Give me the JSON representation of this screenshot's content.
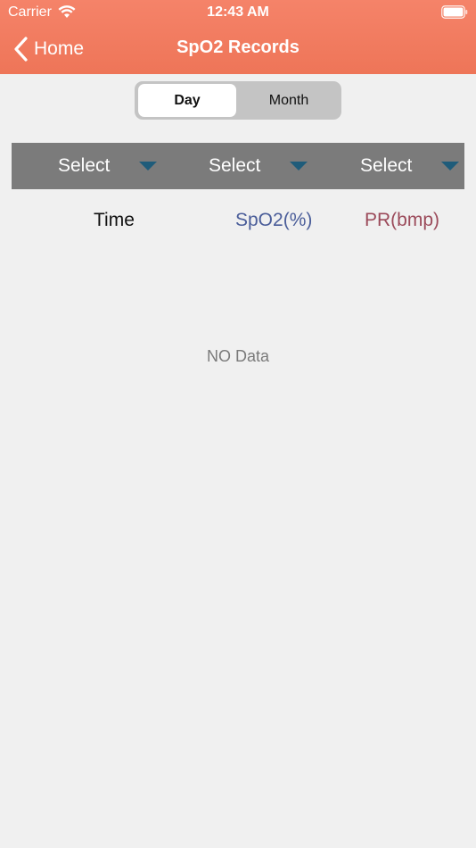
{
  "status_bar": {
    "carrier": "Carrier",
    "time": "12:43 AM",
    "wifi_icon": "wifi-icon",
    "battery_icon": "battery-icon"
  },
  "nav": {
    "back_label": "Home",
    "back_icon": "chevron-left-icon",
    "title": "SpO2 Records"
  },
  "segments": {
    "day": "Day",
    "month": "Month",
    "selected": "Day"
  },
  "filters": [
    {
      "label": "Select",
      "icon": "caret-down-icon"
    },
    {
      "label": "Select",
      "icon": "caret-down-icon"
    },
    {
      "label": "Select",
      "icon": "caret-down-icon"
    }
  ],
  "columns": {
    "time": "Time",
    "spo2": "SpO2(%)",
    "pr": "PR(bmp)"
  },
  "empty_message": "NO Data",
  "colors": {
    "header": "#f07a5d",
    "filter_bar": "#7b7b7b",
    "caret": "#1f5c7a",
    "spo2_text": "#4a5d99",
    "pr_text": "#9b4a5a",
    "background": "#f0f0f0"
  }
}
